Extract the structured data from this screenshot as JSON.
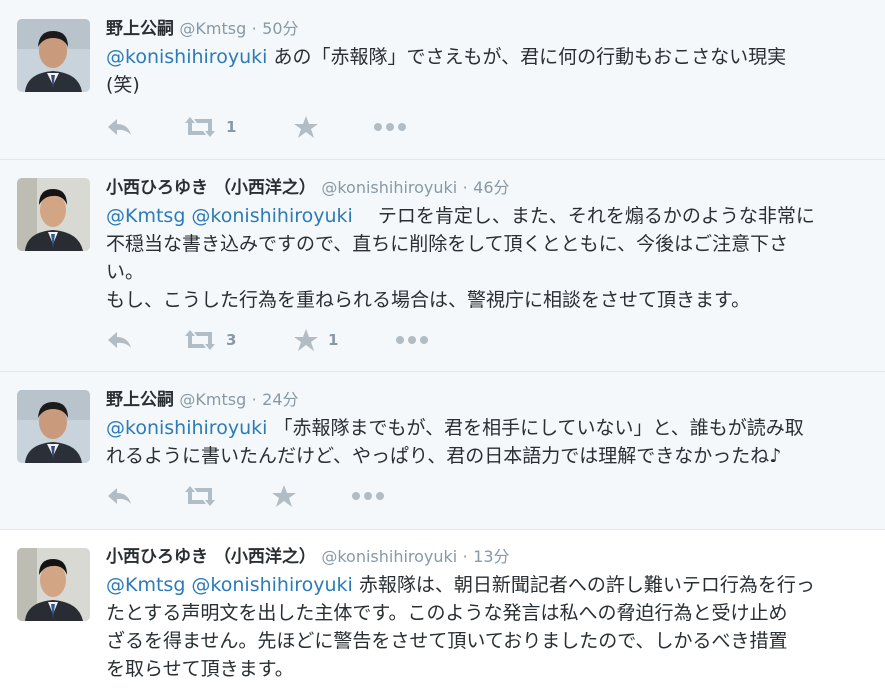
{
  "tweets": [
    {
      "name": "野上公嗣",
      "handle": "@Kmtsg",
      "sep": "·",
      "time": "50分",
      "lines": [
        {
          "mention": "@konishihiroyuki",
          "text": " あの「赤報隊」でさえもが、君に何の行動もおこさない現実"
        },
        {
          "mention": "",
          "text": "(笑)"
        }
      ],
      "retweet_count": "1",
      "favorite_count": "",
      "icons": [
        "reply-icon",
        "retweet-icon",
        "favorite-icon",
        "more-icon"
      ]
    },
    {
      "name": "小西ひろゆき （小西洋之）",
      "handle": "@konishihiroyuki",
      "sep": "·",
      "time": "46分",
      "lines": [
        {
          "mention": "@Kmtsg @konishihiroyuki",
          "text": "　 テロを肯定し、また、それを煽るかのような非常に"
        },
        {
          "mention": "",
          "text": "不穏当な書き込みですので、直ちに削除をして頂くとともに、今後はご注意下さ"
        },
        {
          "mention": "",
          "text": "い。"
        },
        {
          "mention": "",
          "text": "もし、こうした行為を重ねられる場合は、警視庁に相談をさせて頂きます。"
        }
      ],
      "retweet_count": "3",
      "favorite_count": "1",
      "icons": [
        "reply-icon",
        "retweet-icon",
        "favorite-icon",
        "more-icon"
      ]
    },
    {
      "name": "野上公嗣",
      "handle": "@Kmtsg",
      "sep": "·",
      "time": "24分",
      "lines": [
        {
          "mention": "@konishihiroyuki",
          "text": " 「赤報隊までもが、君を相手にしていない」と、誰もが読み取"
        },
        {
          "mention": "",
          "text": "れるように書いたんだけど、やっぱり、君の日本語力では理解できなかったね♪"
        }
      ],
      "retweet_count": "",
      "favorite_count": "",
      "icons": [
        "reply-icon",
        "retweet-icon",
        "favorite-icon",
        "more-icon"
      ]
    },
    {
      "name": "小西ひろゆき （小西洋之）",
      "handle": "@konishihiroyuki",
      "sep": "·",
      "time": "13分",
      "lines": [
        {
          "mention": "@Kmtsg @konishihiroyuki",
          "text": " 赤報隊は、朝日新聞記者への許し難いテロ行為を行っ"
        },
        {
          "mention": "",
          "text": "たとする声明文を出した主体です。このような発言は私への脅迫行為と受け止め"
        },
        {
          "mention": "",
          "text": "ざるを得ません。先ほどに警告をさせて頂いておりましたので、しかるべき措置"
        },
        {
          "mention": "",
          "text": "を取らせて頂きます。"
        }
      ],
      "retweet_count": "",
      "favorite_count": "",
      "icons": [
        "reply-icon",
        "retweet-icon",
        "favorite-icon",
        "more-icon"
      ]
    }
  ],
  "colors": {
    "mention": "#2b7bb9",
    "muted": "#8899a6",
    "text": "#292f33",
    "icon": "#b1bcc4"
  }
}
